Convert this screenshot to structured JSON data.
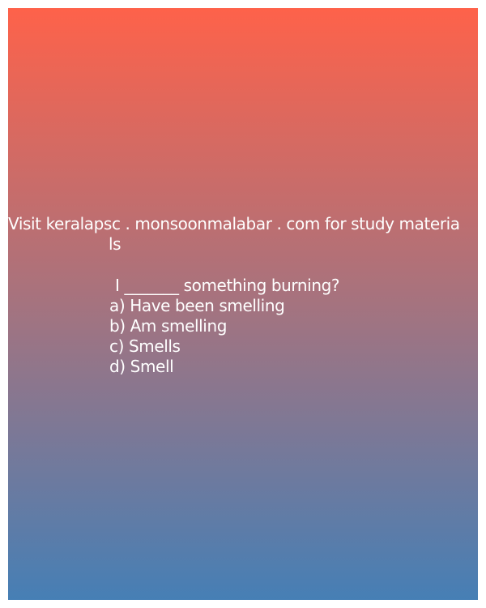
{
  "promo": {
    "line1": "Visit keralapsc . monsoonmalabar . com for study materia",
    "line2": "ls"
  },
  "question": {
    "stem": "I _______ something burning?",
    "options": [
      "a) Have been smelling",
      "b) Am smelling",
      "c) Smells",
      "d) Smell"
    ]
  },
  "colors": {
    "gradient_top": "#fe624a",
    "gradient_bottom": "#467fb5",
    "text": "#ffffff"
  }
}
